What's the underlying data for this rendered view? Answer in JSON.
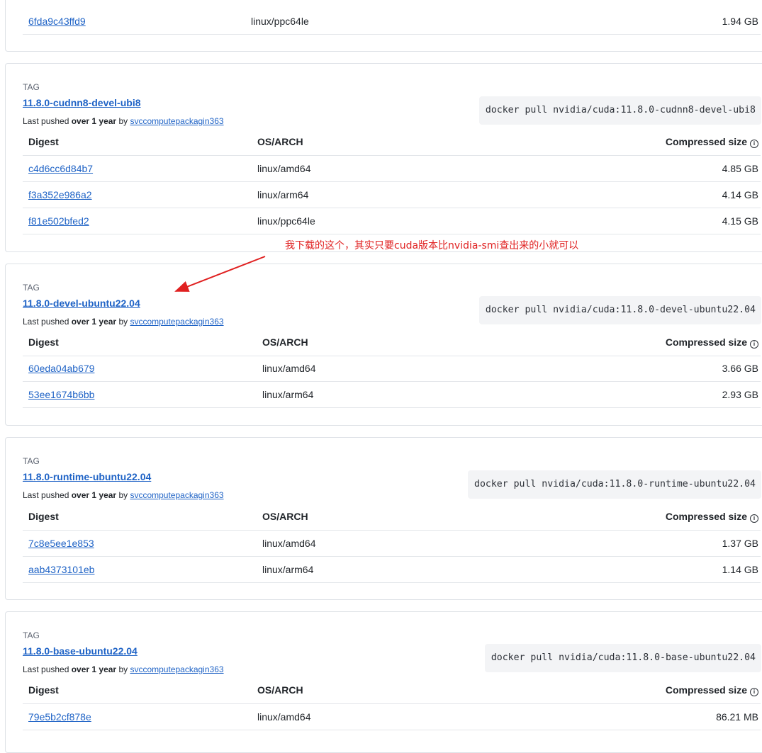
{
  "top_row": {
    "digest": "6fda9c43ffd9",
    "os_arch": "linux/ppc64le",
    "size": "1.94 GB"
  },
  "common": {
    "tag_label": "TAG",
    "pushed_prefix": "Last pushed ",
    "pushed_when": "over 1 year",
    "pushed_by": " by ",
    "user": "svccomputepackagin363",
    "col_digest": "Digest",
    "col_os": "OS/ARCH",
    "col_size": "Compressed size",
    "info_glyph": "i"
  },
  "cards": [
    {
      "tag": "11.8.0-cudnn8-devel-ubi8",
      "pull": "docker pull nvidia/cuda:11.8.0-cudnn8-devel-ubi8",
      "rows": [
        {
          "digest": "c4d6cc6d84b7",
          "os_arch": "linux/amd64",
          "size": "4.85 GB"
        },
        {
          "digest": "f3a352e986a2",
          "os_arch": "linux/arm64",
          "size": "4.14 GB"
        },
        {
          "digest": "f81e502bfed2",
          "os_arch": "linux/ppc64le",
          "size": "4.15 GB"
        }
      ]
    },
    {
      "tag": "11.8.0-devel-ubuntu22.04",
      "pull": "docker pull nvidia/cuda:11.8.0-devel-ubuntu22.04",
      "rows": [
        {
          "digest": "60eda04ab679",
          "os_arch": "linux/amd64",
          "size": "3.66 GB"
        },
        {
          "digest": "53ee1674b6bb",
          "os_arch": "linux/arm64",
          "size": "2.93 GB"
        }
      ]
    },
    {
      "tag": "11.8.0-runtime-ubuntu22.04",
      "pull": "docker pull nvidia/cuda:11.8.0-runtime-ubuntu22.04",
      "rows": [
        {
          "digest": "7c8e5ee1e853",
          "os_arch": "linux/amd64",
          "size": "1.37 GB"
        },
        {
          "digest": "aab4373101eb",
          "os_arch": "linux/arm64",
          "size": "1.14 GB"
        }
      ]
    },
    {
      "tag": "11.8.0-base-ubuntu22.04",
      "pull": "docker pull nvidia/cuda:11.8.0-base-ubuntu22.04",
      "rows": [
        {
          "digest": "79e5b2cf878e",
          "os_arch": "linux/amd64",
          "size": "86.21 MB"
        }
      ]
    }
  ],
  "annotation": {
    "text": "我下载的这个，其实只要cuda版本比nvidia-smi查出来的小就可以",
    "color": "#e02020"
  },
  "colors": {
    "link": "#1f63c6",
    "border": "#dde1e6",
    "code_bg": "#f3f4f6"
  }
}
